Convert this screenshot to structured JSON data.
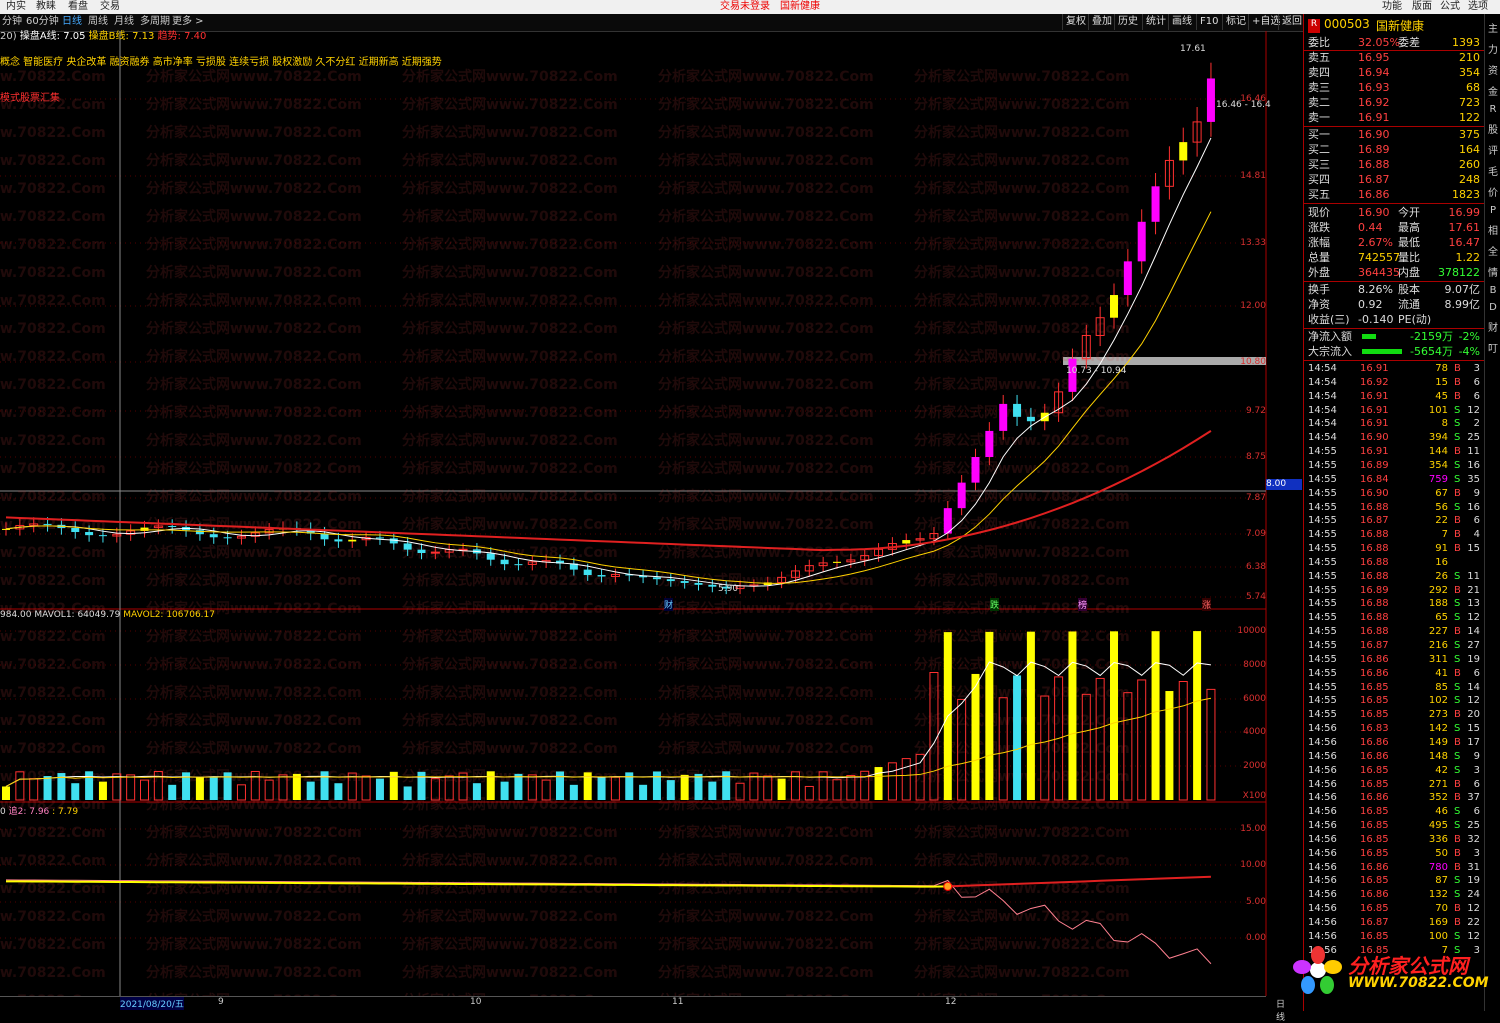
{
  "topmenu": {
    "items": [
      "内实",
      "教睐",
      "看盘",
      "交易"
    ],
    "center_title": "交易未登录",
    "center_stock": "国新健康",
    "right_items": [
      "功能",
      "版面",
      "公式",
      "选项"
    ]
  },
  "toolbar": {
    "periods": [
      "分钟",
      "60分钟",
      "日线",
      "周线",
      "月线",
      "多周期",
      "更多 >"
    ],
    "right_buttons": [
      "复权",
      "叠加",
      "历史",
      "统计",
      "画线",
      "F10",
      "标记",
      "+自选",
      "返回"
    ]
  },
  "main": {
    "prefix": "20)",
    "ma_label": "操盘A线: ",
    "ma_value": "7.05",
    "mb_label": "操盘B线: ",
    "mb_value": "7.13",
    "mc_label": "趋势: ",
    "mc_value": "7.40",
    "concepts": "概念 智能医疗 央企改革 融资融券 高市净率 亏损股 连续亏损 股权激励 久不分红 近期新高 近期强势",
    "red_label": "模式股票汇集",
    "price_hi": "17.61",
    "label_1646": "16.46 - 16.4",
    "label_1073": "10.73 - 10.94",
    "label_590": "5.90",
    "axis": [
      "16.46",
      "14.81",
      "13.33",
      "12.00",
      "10.80",
      "9.72",
      "8.75",
      "7.87",
      "7.09",
      "6.38",
      "5.74"
    ],
    "cross_value": "8.00",
    "event_tags": [
      "财",
      "跌",
      "榜",
      "涨"
    ]
  },
  "volume": {
    "info_prefix": "984.00",
    "mavol1_label": "MAVOL1: ",
    "mavol1": "64049.79",
    "mavol2_label": "MAVOL2: ",
    "mavol2": "106706.17",
    "axis": [
      "10000",
      "8000",
      "6000",
      "4000",
      "2000"
    ],
    "unit": "X100"
  },
  "indicator": {
    "prefix": "0",
    "l1": "追2: 7.96",
    "l2": ": 7.79",
    "axis": [
      "15.00",
      "10.00",
      "5.00",
      "0.00"
    ]
  },
  "bottom": {
    "date": "2021/08/20/五",
    "ticks": [
      "9",
      "10",
      "11",
      "12"
    ],
    "right": "日线"
  },
  "right": {
    "code": "000503",
    "name": "国新健康",
    "wb": [
      [
        "委比",
        "32.05%",
        "委差",
        "1393"
      ]
    ],
    "sell": [
      [
        "卖五",
        "16.95",
        "210"
      ],
      [
        "卖四",
        "16.94",
        "354"
      ],
      [
        "卖三",
        "16.93",
        "68"
      ],
      [
        "卖二",
        "16.92",
        "723"
      ],
      [
        "卖一",
        "16.91",
        "122"
      ]
    ],
    "buy": [
      [
        "买一",
        "16.90",
        "375"
      ],
      [
        "买二",
        "16.89",
        "164"
      ],
      [
        "买三",
        "16.88",
        "260"
      ],
      [
        "买四",
        "16.87",
        "248"
      ],
      [
        "买五",
        "16.86",
        "1823"
      ]
    ],
    "quote": [
      [
        "现价",
        "16.90",
        "今开",
        "16.99"
      ],
      [
        "涨跌",
        "0.44",
        "最高",
        "17.61"
      ],
      [
        "涨幅",
        "2.67%",
        "最低",
        "16.47"
      ],
      [
        "总量",
        "742557",
        "量比",
        "1.22"
      ],
      [
        "外盘",
        "364435",
        "内盘",
        "378122"
      ]
    ],
    "stats": [
      [
        "换手",
        "8.26%",
        "股本",
        "9.07亿"
      ],
      [
        "净资",
        "0.92",
        "流通",
        "8.99亿"
      ],
      [
        "收益(三)",
        "-0.140",
        "PE(动)",
        ""
      ]
    ],
    "flows": [
      [
        "净流入额",
        "-2159万",
        "-2%"
      ],
      [
        "大宗流入",
        "-5654万",
        "-4%"
      ]
    ],
    "ticks": [
      [
        "14:54",
        "16.91",
        "78",
        "B",
        "3"
      ],
      [
        "14:54",
        "16.92",
        "15",
        "B",
        "6"
      ],
      [
        "14:54",
        "16.91",
        "45",
        "B",
        "6"
      ],
      [
        "14:54",
        "16.91",
        "101",
        "S",
        "12"
      ],
      [
        "14:54",
        "16.91",
        "8",
        "S",
        "2"
      ],
      [
        "14:54",
        "16.90",
        "394",
        "S",
        "25"
      ],
      [
        "14:55",
        "16.91",
        "144",
        "B",
        "11"
      ],
      [
        "14:55",
        "16.89",
        "354",
        "S",
        "16"
      ],
      [
        "14:55",
        "16.84",
        "759",
        "S",
        "35"
      ],
      [
        "14:55",
        "16.90",
        "67",
        "B",
        "9"
      ],
      [
        "14:55",
        "16.88",
        "56",
        "S",
        "16"
      ],
      [
        "14:55",
        "16.87",
        "22",
        "B",
        "6"
      ],
      [
        "14:55",
        "16.88",
        "7",
        "B",
        "4"
      ],
      [
        "14:55",
        "16.88",
        "91",
        "B",
        "15"
      ],
      [
        "14:55",
        "16.88",
        "16",
        "",
        ""
      ],
      [
        "14:55",
        "16.88",
        "26",
        "S",
        "11"
      ],
      [
        "14:55",
        "16.89",
        "292",
        "B",
        "21"
      ],
      [
        "14:55",
        "16.88",
        "188",
        "S",
        "13"
      ],
      [
        "14:55",
        "16.88",
        "65",
        "S",
        "12"
      ],
      [
        "14:55",
        "16.88",
        "227",
        "B",
        "14"
      ],
      [
        "14:55",
        "16.87",
        "216",
        "S",
        "27"
      ],
      [
        "14:55",
        "16.86",
        "311",
        "S",
        "19"
      ],
      [
        "14:55",
        "16.86",
        "41",
        "B",
        "6"
      ],
      [
        "14:55",
        "16.85",
        "85",
        "S",
        "14"
      ],
      [
        "14:55",
        "16.85",
        "102",
        "S",
        "12"
      ],
      [
        "14:55",
        "16.85",
        "273",
        "B",
        "20"
      ],
      [
        "14:56",
        "16.83",
        "142",
        "S",
        "15"
      ],
      [
        "14:56",
        "16.86",
        "149",
        "B",
        "17"
      ],
      [
        "14:56",
        "16.86",
        "148",
        "S",
        "9"
      ],
      [
        "14:56",
        "16.85",
        "42",
        "S",
        "3"
      ],
      [
        "14:56",
        "16.85",
        "271",
        "B",
        "6"
      ],
      [
        "14:56",
        "16.86",
        "352",
        "B",
        "37"
      ],
      [
        "14:56",
        "16.85",
        "46",
        "S",
        "6"
      ],
      [
        "14:56",
        "16.85",
        "495",
        "S",
        "25"
      ],
      [
        "14:56",
        "16.85",
        "336",
        "B",
        "32"
      ],
      [
        "14:56",
        "16.85",
        "50",
        "B",
        "3"
      ],
      [
        "14:56",
        "16.86",
        "780",
        "B",
        "31"
      ],
      [
        "14:56",
        "16.85",
        "87",
        "S",
        "19"
      ],
      [
        "14:56",
        "16.86",
        "132",
        "S",
        "24"
      ],
      [
        "14:56",
        "16.85",
        "70",
        "B",
        "12"
      ],
      [
        "14:56",
        "16.87",
        "169",
        "B",
        "22"
      ],
      [
        "14:56",
        "16.85",
        "100",
        "S",
        "12"
      ],
      [
        "14:56",
        "16.85",
        "7",
        "S",
        "3"
      ]
    ]
  },
  "sidebar_chars": [
    "主",
    "力",
    "资",
    "金",
    "R",
    "股",
    "评",
    "毛",
    "价",
    "P",
    "相",
    "全",
    "情",
    "B",
    "D",
    "财",
    "叮"
  ],
  "logo": {
    "l1": "分析家公式网",
    "l2": "WWW.70822.COM"
  },
  "watermark": "分析家公式网www.70822.Com"
}
